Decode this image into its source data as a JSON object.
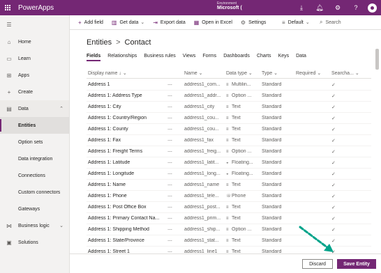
{
  "app": {
    "name": "PowerApps"
  },
  "environment": {
    "label": "Environment",
    "value": "Microsoft ("
  },
  "header": {
    "icons": [
      "download-icon",
      "bell-icon",
      "gear-icon",
      "help-icon",
      "avatar"
    ]
  },
  "leftnav": {
    "items": [
      {
        "label": "Home",
        "icon": "home-icon"
      },
      {
        "label": "Learn",
        "icon": "book-icon"
      },
      {
        "label": "Apps",
        "icon": "apps-icon"
      },
      {
        "label": "Create",
        "icon": "plus-icon"
      },
      {
        "label": "Data",
        "icon": "data-icon"
      },
      {
        "label": "Entities"
      },
      {
        "label": "Option sets"
      },
      {
        "label": "Data integration"
      },
      {
        "label": "Connections"
      },
      {
        "label": "Custom connectors"
      },
      {
        "label": "Gateways"
      },
      {
        "label": "Business logic",
        "icon": "logic-icon"
      },
      {
        "label": "Solutions",
        "icon": "solutions-icon"
      }
    ]
  },
  "commandbar": {
    "add_field": "Add field",
    "get_data": "Get data",
    "export_data": "Export data",
    "open_excel": "Open in Excel",
    "settings": "Settings",
    "view_default": "Default",
    "search": "Search"
  },
  "breadcrumb": {
    "parent": "Entities",
    "sep": ">",
    "current": "Contact"
  },
  "tabs": [
    "Fields",
    "Relationships",
    "Business rules",
    "Views",
    "Forms",
    "Dashboards",
    "Charts",
    "Keys",
    "Data"
  ],
  "columns": {
    "display_name": "Display name",
    "name": "Name",
    "data_type": "Data type",
    "type": "Type",
    "required": "Required",
    "searchable": "Searcha..."
  },
  "rows": [
    {
      "display": "Address 1",
      "name": "address1_com...",
      "dtype": "Multilin...",
      "dicon": "≡",
      "type": "Standard"
    },
    {
      "display": "Address 1: Address Type",
      "name": "address1_addr...",
      "dtype": "Option ...",
      "dicon": "≡",
      "type": "Standard"
    },
    {
      "display": "Address 1: City",
      "name": "address1_city",
      "dtype": "Text",
      "dicon": "≡",
      "type": "Standard"
    },
    {
      "display": "Address 1: Country/Region",
      "name": "address1_cou...",
      "dtype": "Text",
      "dicon": "≡",
      "type": "Standard"
    },
    {
      "display": "Address 1: County",
      "name": "address1_cou...",
      "dtype": "Text",
      "dicon": "≡",
      "type": "Standard"
    },
    {
      "display": "Address 1: Fax",
      "name": "address1_fax",
      "dtype": "Text",
      "dicon": "≡",
      "type": "Standard"
    },
    {
      "display": "Address 1: Freight Terms",
      "name": "address1_freig...",
      "dtype": "Option ...",
      "dicon": "≡",
      "type": "Standard"
    },
    {
      "display": "Address 1: Latitude",
      "name": "address1_latit...",
      "dtype": "Floating...",
      "dicon": "◒",
      "type": "Standard"
    },
    {
      "display": "Address 1: Longitude",
      "name": "address1_long...",
      "dtype": "Floating...",
      "dicon": "◒",
      "type": "Standard"
    },
    {
      "display": "Address 1: Name",
      "name": "address1_name",
      "dtype": "Text",
      "dicon": "≡",
      "type": "Standard"
    },
    {
      "display": "Address 1: Phone",
      "name": "address1_tele...",
      "dtype": "Phone",
      "dicon": "☏",
      "type": "Standard"
    },
    {
      "display": "Address 1: Post Office Box",
      "name": "address1_post...",
      "dtype": "Text",
      "dicon": "≡",
      "type": "Standard"
    },
    {
      "display": "Address 1: Primary Contact Na...",
      "name": "address1_prim...",
      "dtype": "Text",
      "dicon": "≡",
      "type": "Standard"
    },
    {
      "display": "Address 1: Shipping Method",
      "name": "address1_ship...",
      "dtype": "Option ...",
      "dicon": "≡",
      "type": "Standard"
    },
    {
      "display": "Address 1: State/Province",
      "name": "address1_stat...",
      "dtype": "Text",
      "dicon": "≡",
      "type": "Standard"
    },
    {
      "display": "Address 1: Street 1",
      "name": "address1_line1",
      "dtype": "Text",
      "dicon": "≡",
      "type": "Standard"
    }
  ],
  "footer": {
    "discard": "Discard",
    "save": "Save Entity"
  },
  "colors": {
    "brand": "#742774",
    "annotation": "#00a38a"
  }
}
